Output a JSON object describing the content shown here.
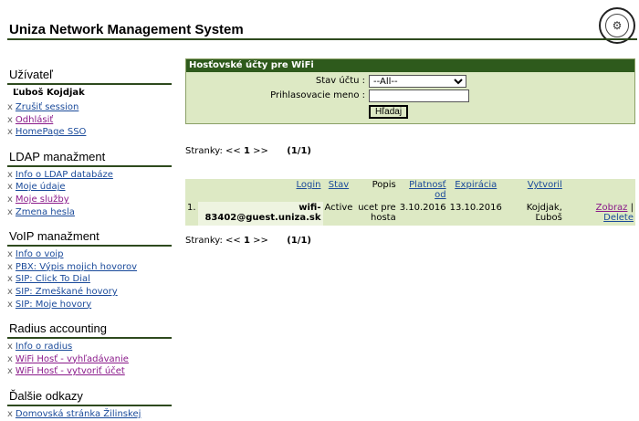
{
  "header": {
    "title": "Uniza Network Management System"
  },
  "sidebar": {
    "user": {
      "title": "Užívateľ",
      "name": "Ľuboš Kojdjak",
      "items": [
        "Zrušiť session",
        "Odhlásiť",
        "HomePage SSO"
      ]
    },
    "ldap": {
      "title": "LDAP manažment",
      "items": [
        "Info o LDAP databáze",
        "Moje údaje",
        "Moje služby",
        "Zmena hesla"
      ]
    },
    "voip": {
      "title": "VoIP manažment",
      "items": [
        "Info o voip",
        "PBX: Výpis mojich hovorov",
        "SIP: Click To Dial",
        "SIP: Zmeškané hovory",
        "SIP: Moje hovory"
      ]
    },
    "radius": {
      "title": "Radius accounting",
      "items": [
        "Info o radius",
        "WiFi Hosť - vyhľadávanie",
        "WiFi Hosť - vytvoriť účet"
      ]
    },
    "links": {
      "title": "Ďalšie odkazy",
      "items": [
        "Domovská stránka Žilinskej"
      ]
    }
  },
  "search": {
    "title": "Hosťovské účty pre WiFi",
    "status_label": "Stav účtu :",
    "status_value": "--All--",
    "login_label": "Prihlasovacie meno :",
    "login_value": "",
    "button": "Hľadaj"
  },
  "pager": {
    "label": "Stranky:",
    "prev": "<<",
    "current": "1",
    "next": ">>",
    "summary": "(1/1)"
  },
  "table": {
    "headers": {
      "login": "Login",
      "stav": "Stav",
      "popis": "Popis",
      "platnost": "Platnosť od",
      "expiracia": "Expirácia",
      "vytvoril": "Vytvoril"
    },
    "rows": [
      {
        "num": "1.",
        "login": "wifi-83402@guest.uniza.sk",
        "stav": "Active",
        "popis": "ucet pre hosta",
        "platnost": "3.10.2016",
        "expiracia": "13.10.2016",
        "vytvoril": "Kojdjak, Ľuboš",
        "action_view": "Zobraz",
        "sep": "|",
        "action_delete": "Delete"
      }
    ]
  }
}
